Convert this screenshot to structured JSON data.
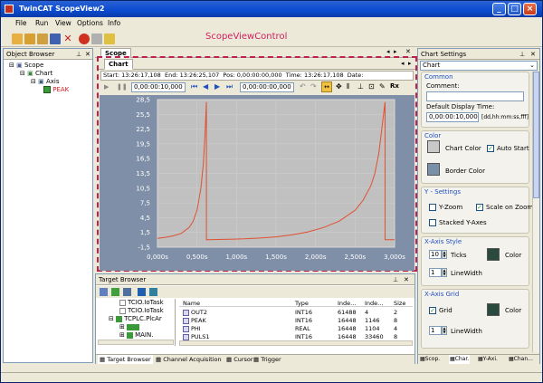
{
  "app": {
    "title": "TwinCAT ScopeView2"
  },
  "menu": [
    "File",
    "Run",
    "View",
    "Options",
    "Info"
  ],
  "annotation": "ScopeViewControl",
  "object_browser": {
    "title": "Object Browser",
    "tree": [
      "Scope",
      "Chart",
      "Axis",
      "PEAK"
    ]
  },
  "scope_tab": {
    "title": "Scope",
    "chart_tab": "Chart"
  },
  "info_bar": {
    "start_label": "Start:",
    "start": "13:26:17,108",
    "end_label": "End:",
    "end": "13:26:25,107",
    "pos_label": "Pos:",
    "pos": "0,00:00:00,000",
    "time_label": "Time:",
    "time": "13:26:17,108",
    "date_label": "Date:"
  },
  "toolbar2": {
    "time1": "0,00:00:10,000",
    "time2": "0,00:00:00,000"
  },
  "chart_data": {
    "type": "line",
    "title": "",
    "xlabel": "",
    "ylabel": "",
    "x_ticks": [
      "0,000s",
      "0,500s",
      "1,000s",
      "1,500s",
      "2,000s",
      "2,500s",
      "3,000s"
    ],
    "y_ticks": [
      "28,5",
      "25,5",
      "22,5",
      "19,5",
      "16,5",
      "13,5",
      "10,5",
      "7,5",
      "4,5",
      "1,5",
      "-1,5"
    ],
    "xlim": [
      0,
      3.0
    ],
    "ylim": [
      -1.5,
      28.5
    ],
    "series": [
      {
        "color": "#e05030",
        "x": [
          0.0,
          0.1,
          0.2,
          0.3,
          0.4,
          0.45,
          0.5,
          0.55,
          0.58,
          0.6,
          0.62,
          0.62,
          0.7,
          0.9,
          1.1,
          1.3,
          1.5,
          1.7,
          1.9,
          2.1,
          2.3,
          2.5,
          2.6,
          2.7,
          2.75,
          2.8,
          2.83,
          2.86,
          2.88,
          2.88,
          3.0
        ],
        "y": [
          0.3,
          0.5,
          0.8,
          1.3,
          2.5,
          3.7,
          6.0,
          10.5,
          15.5,
          21.0,
          28.0,
          0.0,
          0.05,
          0.1,
          0.2,
          0.35,
          0.6,
          1.0,
          1.6,
          2.5,
          3.8,
          6.0,
          8.0,
          11.0,
          13.5,
          17.5,
          21.5,
          25.5,
          28.0,
          0.0,
          0.0
        ]
      }
    ],
    "plot_bg": "#c0c0c0",
    "area_bg": "#7f8fa8",
    "grid": true
  },
  "target_browser": {
    "title": "Target Browser",
    "tree": [
      "TCIO.IoTask",
      "TCIO.IoTask",
      "TCPLC.PlcAr",
      "MAIN."
    ],
    "columns": [
      "Name",
      "Type",
      "Inde...",
      "Inde...",
      "Size"
    ],
    "rows": [
      [
        "OUT2",
        "INT16",
        "61488",
        "4",
        "2"
      ],
      [
        "PEAK",
        "INT16",
        "16448",
        "1146",
        "8"
      ],
      [
        "PHI",
        "REAL",
        "16448",
        "1104",
        "4"
      ],
      [
        "PULS1",
        "INT16",
        "16448",
        "33460",
        "8"
      ]
    ],
    "bottom_tabs": [
      "Target Browser",
      "Channel Acquisition",
      "Cursor",
      "Trigger"
    ]
  },
  "chart_settings": {
    "title": "Chart Settings",
    "selector": "Chart",
    "common": {
      "title": "Common",
      "comment_label": "Comment:",
      "comment": "",
      "display_time_label": "Default Display Time:",
      "display_time": "0,00:00:10,000",
      "format": "[dd,hh:mm:ss,fff]"
    },
    "color": {
      "title": "Color",
      "chart_color": "Chart Color",
      "auto_start": "Auto Start",
      "border_color": "Border Color",
      "chart_color_value": "#c8c8c8",
      "border_color_value": "#7890a8"
    },
    "y_settings": {
      "title": "Y - Settings",
      "y_zoom": "Y-Zoom",
      "scale_on_zoom": "Scale on Zoom",
      "stacked": "Stacked Y-Axes"
    },
    "x_style": {
      "title": "X-Axis Style",
      "ticks_value": "10",
      "ticks": "Ticks",
      "color": "Color",
      "line_width_value": "1",
      "line_width": "LineWidth",
      "color_value": "#2a4a40"
    },
    "x_grid": {
      "title": "X-Axis Grid",
      "grid": "Grid",
      "color": "Color",
      "line_width_value": "1",
      "line_width": "LineWidth",
      "color_value": "#2a4a40"
    },
    "bottom_tabs": [
      "Scop.",
      "Char.",
      "Y-Axi.",
      "Chan..."
    ]
  }
}
